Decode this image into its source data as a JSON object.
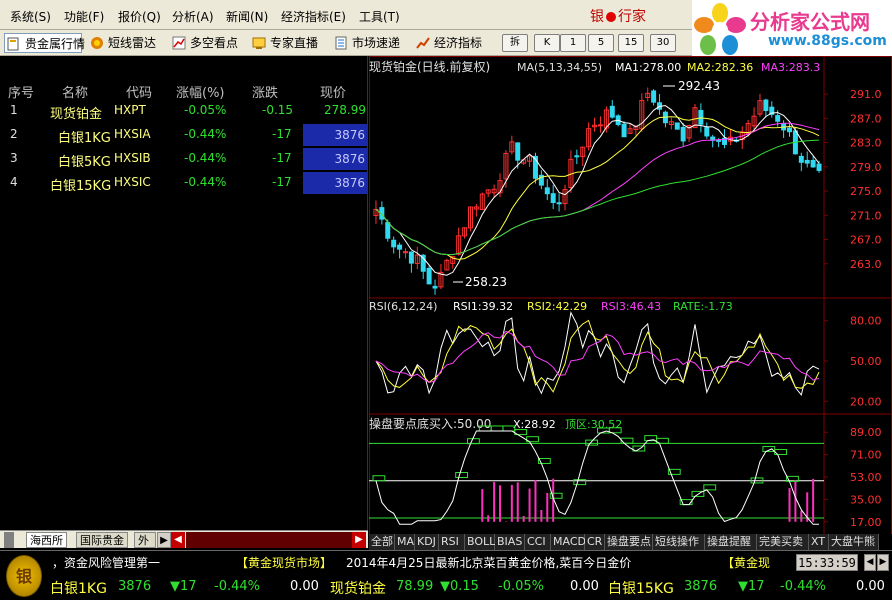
{
  "menu": [
    "系统(S)",
    "功能(F)",
    "报价(Q)",
    "分析(A)",
    "新闻(N)",
    "经济指标(E)",
    "工具(T)"
  ],
  "brand": {
    "left": "银",
    "right": "行家"
  },
  "logo": {
    "title": "分析家公式网",
    "url": "www.88gs.com"
  },
  "toolbar": {
    "items": [
      "贵金属行情",
      "短线雷达",
      "多空看点",
      "专家直播",
      "市场速递",
      "经济指标"
    ],
    "buttons": [
      "拆",
      "K",
      "1",
      "5",
      "15",
      "30"
    ]
  },
  "quote_table": {
    "headers": [
      "序号",
      "名称",
      "代码",
      "涨幅(%)",
      "涨跌",
      "现价"
    ],
    "rows": [
      {
        "no": "1",
        "name": "现货铂金",
        "code": "HXPT",
        "pct": "-0.05%",
        "chg": "-0.15",
        "price": "278.99",
        "hl": false
      },
      {
        "no": "2",
        "name": "白银1KG",
        "code": "HXSIA",
        "pct": "-0.44%",
        "chg": "-17",
        "price": "3876",
        "hl": true
      },
      {
        "no": "3",
        "name": "白银5KG",
        "code": "HXSIB",
        "pct": "-0.44%",
        "chg": "-17",
        "price": "3876",
        "hl": true
      },
      {
        "no": "4",
        "name": "白银15KG",
        "code": "HXSIC",
        "pct": "-0.44%",
        "chg": "-17",
        "price": "3876",
        "hl": true
      }
    ]
  },
  "left_tabs": [
    "海西所",
    "国际贵金",
    "外"
  ],
  "main_chart": {
    "header_title": "现货铂金(日线.前复权)",
    "ma_spec": "MA(5,13,34,55)",
    "ma1": "MA1:278.00",
    "ma2": "MA2:282.36",
    "ma3": "MA3:283.3",
    "y_ticks": [
      "291.0",
      "287.0",
      "283.0",
      "279.0",
      "275.0",
      "271.0",
      "267.0",
      "263.0"
    ],
    "y_range": [
      259,
      293
    ],
    "high_label": "292.43",
    "low_label": "258.23",
    "colors": {
      "up": "#ff3030",
      "down": "#30d8f0",
      "ma1": "#ffffff",
      "ma2": "#ffff40",
      "ma3": "#ff40ff",
      "ma4": "#30e030"
    }
  },
  "rsi_chart": {
    "title": "RSI(6,12,24)",
    "rsi1": "RSI1:39.32",
    "rsi2": "RSI2:42.29",
    "rsi3": "RSI3:46.43",
    "rate": "RATE:-1.73",
    "y_ticks": [
      "80.00",
      "50.00",
      "20.00"
    ],
    "y_range": [
      15,
      88
    ]
  },
  "signal_chart": {
    "title": "操盘要点底买入:50.00",
    "x": "X:28.92",
    "zone": "顶区:30.52",
    "y_ticks": [
      "89.00",
      "71.00",
      "53.00",
      "35.00",
      "17.00"
    ],
    "y_range": [
      12,
      94
    ]
  },
  "bottom_tabs": [
    "全部",
    "MA",
    "KDJ",
    "RSI",
    "BOLL",
    "BIAS",
    "CCI",
    "MACD",
    "CR",
    "操盘要点",
    "短线操作",
    "操盘提醒",
    "完美买卖",
    "XT",
    "大盘牛熊"
  ],
  "ticker": {
    "news_prefix": "，资金风险管理第一",
    "news_source": "【黄金现货市场】",
    "news_text": "2014年4月25日最新北京菜百黄金价格,菜百今日金价",
    "news_suffix": "【黄金现",
    "clock": "15:33:59",
    "logo_text": "银",
    "quotes": [
      {
        "name": "白银1KG",
        "price": "3876",
        "chg": "▼17",
        "pct": "-0.44%",
        "vol": "0.00"
      },
      {
        "name": "现货铂金",
        "price": "78.99",
        "chg": "▼0.15",
        "pct": "-0.05%",
        "vol": "0.00"
      },
      {
        "name": "白银15KG",
        "price": "3876",
        "chg": "▼17",
        "pct": "-0.44%",
        "vol": "0.00"
      }
    ]
  }
}
